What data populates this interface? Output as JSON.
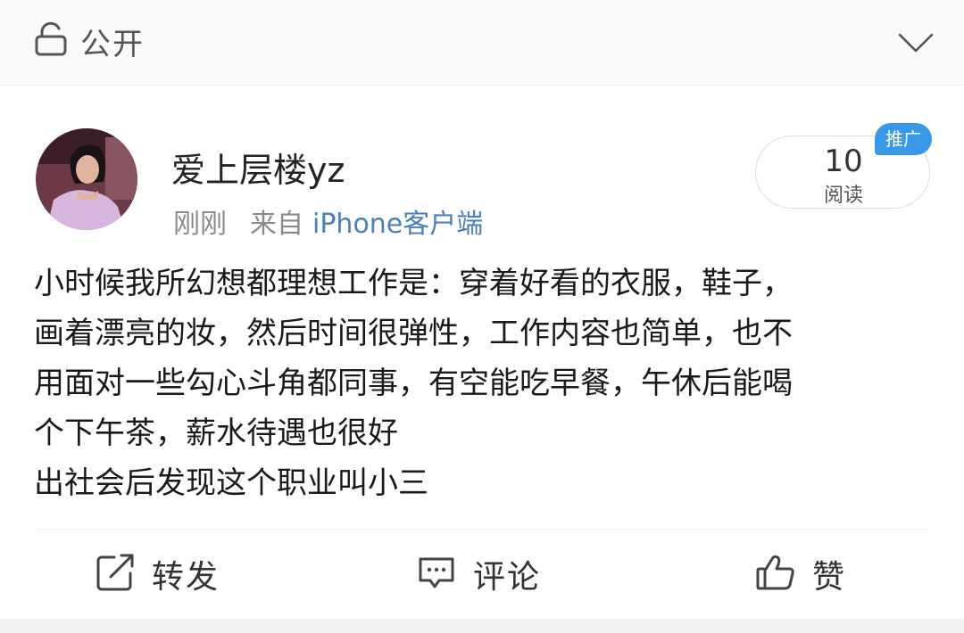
{
  "header": {
    "visibility_label": "公开",
    "icons": {
      "visibility": "lock-open-icon",
      "collapse": "chevron-down-icon"
    }
  },
  "post": {
    "username": "爱上层楼yz",
    "time": "刚刚",
    "source_prefix": "来自",
    "source_client": "iPhone客户端",
    "read_count": "10",
    "read_label": "阅读",
    "promo_badge": "推广",
    "body_lines": [
      "小时候我所幻想都理想工作是：穿着好看的衣服，鞋子，",
      "画着漂亮的妆，然后时间很弹性，工作内容也简单，也不",
      "用面对一些勾心斗角都同事，有空能吃早餐，午休后能喝",
      "个下午茶，薪水待遇也很好",
      "出社会后发现这个职业叫小三"
    ]
  },
  "actions": {
    "repost_label": "转发",
    "comment_label": "评论",
    "like_label": "赞"
  },
  "colors": {
    "link_blue": "#4a7fb8",
    "badge_blue": "#3a99e6",
    "meta_gray": "#8a8a8a",
    "text": "#1a1a1a"
  }
}
